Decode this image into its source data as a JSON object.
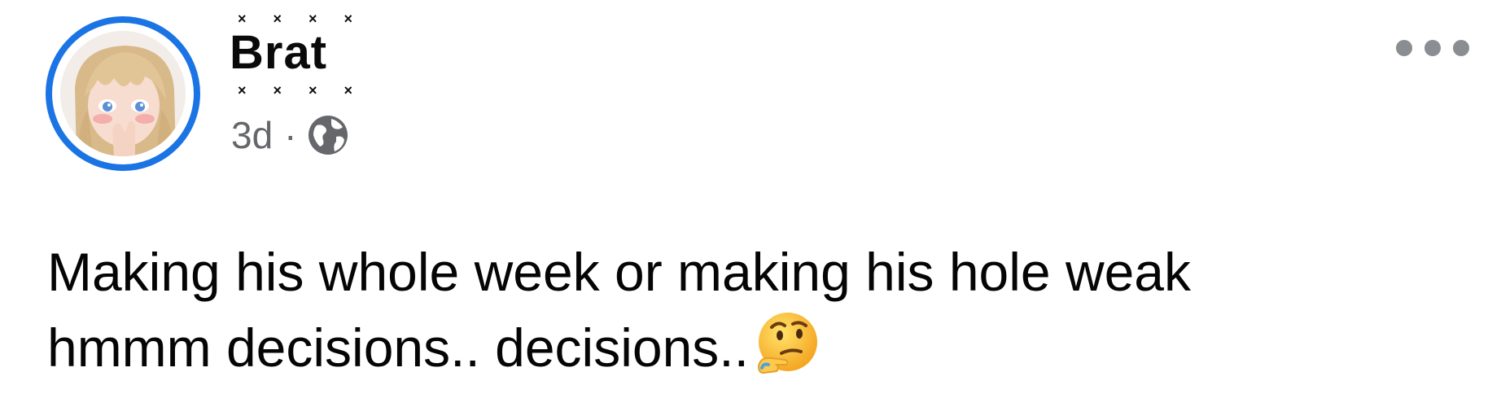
{
  "post": {
    "author": {
      "name": "Brat",
      "decoration": "× × × ×",
      "avatar_icon": "anime-girl-avatar",
      "ring_color": "#1b74e4"
    },
    "timestamp": "3d",
    "separator": "·",
    "audience_icon": "globe-icon",
    "more_icon": "more-options-icon",
    "text": {
      "line1": "Making his whole week or making his hole weak",
      "line2": "hmmm decisions.. decisions.."
    },
    "emoji_icon": "thinking-face-emoji"
  }
}
